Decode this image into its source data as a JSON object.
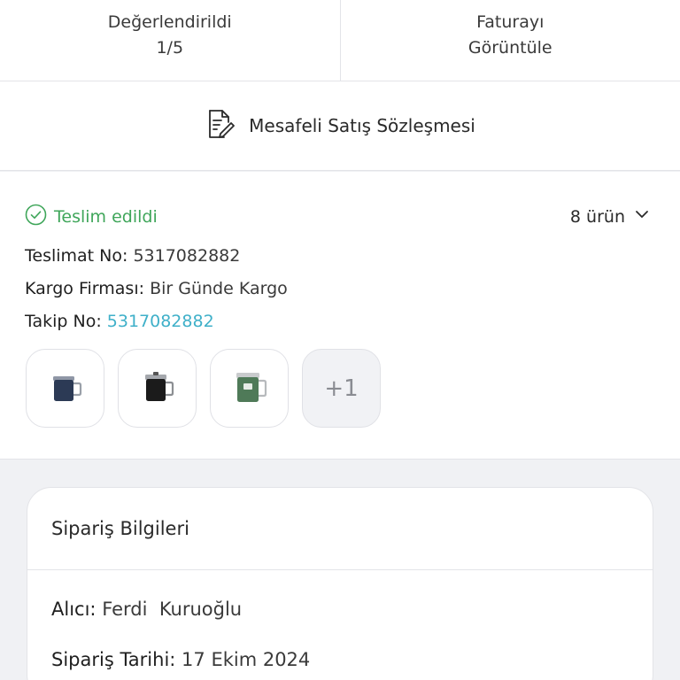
{
  "top_actions": {
    "rated_label": "Değerlendirildi",
    "rated_value": "1/5",
    "invoice_line1": "Faturayı",
    "invoice_line2": "Görüntüle"
  },
  "contract": {
    "label": "Mesafeli Satış Sözleşmesi",
    "icon": "document-edit-icon"
  },
  "delivery": {
    "status": "Teslim edildi",
    "item_count": "8 ürün",
    "delivery_no_label": "Teslimat No:",
    "delivery_no": "5317082882",
    "carrier_label": "Kargo Firması:",
    "carrier": "Bir Günde Kargo",
    "tracking_label": "Takip No:",
    "tracking_no": "5317082882",
    "more_items": "+1",
    "products": [
      {
        "name": "navy-mug",
        "color": "#2c3a55"
      },
      {
        "name": "black-mug",
        "color": "#1b1b1b"
      },
      {
        "name": "green-mug",
        "color": "#4f7a58"
      }
    ],
    "status_color": "#3fa65a",
    "link_color": "#3fb0c9"
  },
  "order": {
    "title": "Sipariş Bilgileri",
    "recipient_label": "Alıcı:",
    "recipient": "Ferdi  Kuruoğlu",
    "date_label": "Sipariş Tarihi:",
    "date": "17 Ekim 2024"
  }
}
